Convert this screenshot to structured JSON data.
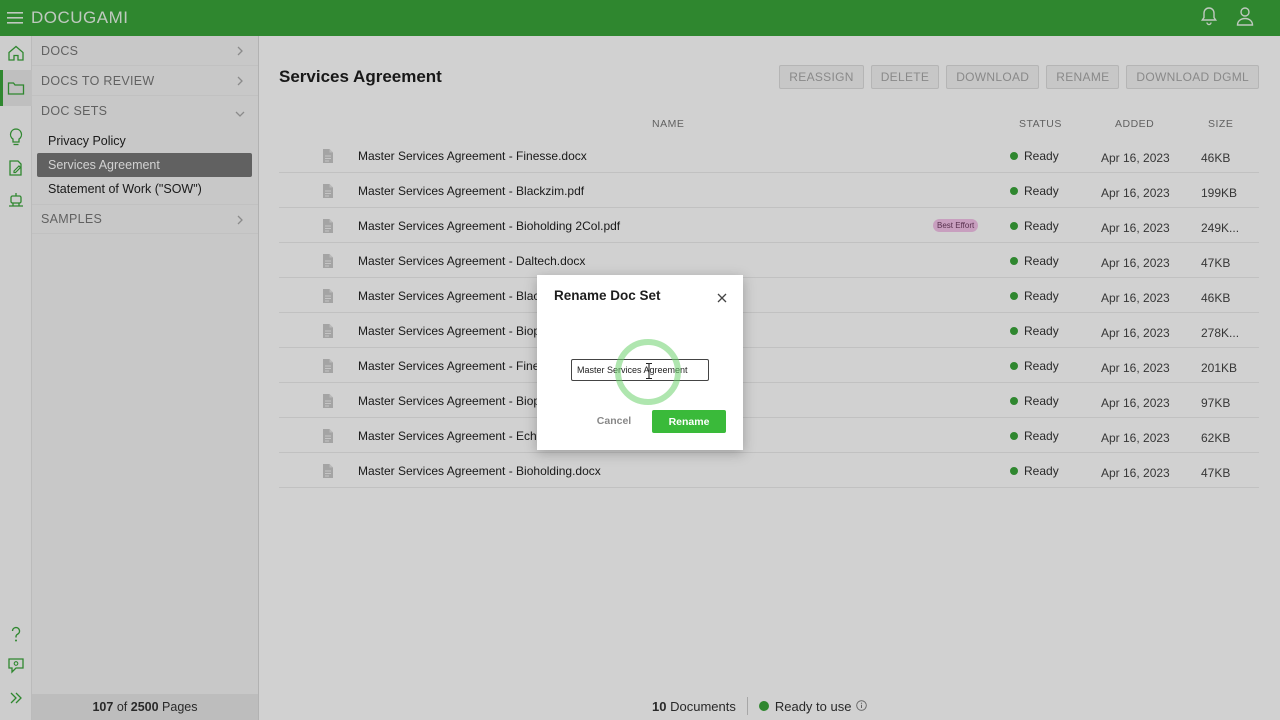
{
  "app": {
    "brand": "DOCUGAMI",
    "brand_color": "#3aa53a"
  },
  "nav": {
    "sections": [
      {
        "label": "DOCS"
      },
      {
        "label": "DOCS TO REVIEW"
      },
      {
        "label": "DOC SETS"
      },
      {
        "label": "SAMPLES"
      }
    ],
    "doc_sets": [
      {
        "label": "Privacy Policy"
      },
      {
        "label": "Services Agreement"
      },
      {
        "label": "Statement of Work (\"SOW\")"
      }
    ],
    "footer": {
      "used": "107",
      "of": "of",
      "total": "2500",
      "unit": "Pages"
    }
  },
  "main": {
    "title": "Services Agreement",
    "actions": [
      "REASSIGN",
      "DELETE",
      "DOWNLOAD",
      "RENAME",
      "DOWNLOAD DGML"
    ],
    "columns": {
      "name": "NAME",
      "status": "STATUS",
      "added": "ADDED",
      "size": "SIZE"
    },
    "rows": [
      {
        "name": "Master Services Agreement - Finesse.docx",
        "badge": "",
        "status": "Ready",
        "added": "Apr 16, 2023",
        "size": "46KB"
      },
      {
        "name": "Master Services Agreement - Blackzim.pdf",
        "badge": "",
        "status": "Ready",
        "added": "Apr 16, 2023",
        "size": "199KB"
      },
      {
        "name": "Master Services Agreement - Bioholding 2Col.pdf",
        "badge": "Best Effort",
        "status": "Ready",
        "added": "Apr 16, 2023",
        "size": "249K..."
      },
      {
        "name": "Master Services Agreement - Daltech.docx",
        "badge": "",
        "status": "Ready",
        "added": "Apr 16, 2023",
        "size": "47KB"
      },
      {
        "name": "Master Services Agreement - Blackz",
        "badge": "",
        "status": "Ready",
        "added": "Apr 16, 2023",
        "size": "46KB"
      },
      {
        "name": "Master Services Agreement - Bioplex",
        "badge": "",
        "status": "Ready",
        "added": "Apr 16, 2023",
        "size": "278K..."
      },
      {
        "name": "Master Services Agreement - Finesse",
        "badge": "",
        "status": "Ready",
        "added": "Apr 16, 2023",
        "size": "201KB"
      },
      {
        "name": "Master Services Agreement - Bioplex",
        "badge": "",
        "status": "Ready",
        "added": "Apr 16, 2023",
        "size": "97KB"
      },
      {
        "name": "Master Services Agreement - Echo F",
        "badge": "",
        "status": "Ready",
        "added": "Apr 16, 2023",
        "size": "62KB"
      },
      {
        "name": "Master Services Agreement - Bioholding.docx",
        "badge": "",
        "status": "Ready",
        "added": "Apr 16, 2023",
        "size": "47KB"
      }
    ],
    "stats": {
      "count": "10",
      "count_label": "Documents",
      "ready_label": "Ready to use"
    }
  },
  "modal": {
    "title": "Rename Doc Set",
    "input_value": "Master Services Agreement",
    "cancel_label": "Cancel",
    "rename_label": "Rename"
  }
}
